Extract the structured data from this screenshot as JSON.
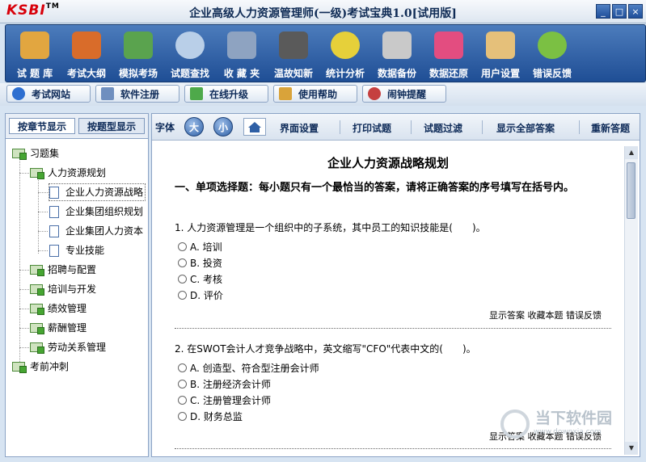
{
  "window": {
    "logo": "KSBI",
    "logo_tm": "TM",
    "title": "企业高级人力资源管理师(一级)考试宝典1.0[试用版]",
    "buttons": [
      "_",
      "□",
      "×"
    ]
  },
  "toolbar": [
    {
      "label": "试 题 库",
      "icon": "book-icon",
      "color": "#e2a640"
    },
    {
      "label": "考试大纲",
      "icon": "calendar-icon",
      "color": "#d96c2a"
    },
    {
      "label": "模拟考场",
      "icon": "clock-icon",
      "color": "#5aa34e"
    },
    {
      "label": "试题查找",
      "icon": "magnifier-icon",
      "color": "#b9cfe8"
    },
    {
      "label": "收 藏 夹",
      "icon": "folder-icon",
      "color": "#8ea3c1"
    },
    {
      "label": "温故知新",
      "icon": "board-icon",
      "color": "#5a5a5a"
    },
    {
      "label": "统计分析",
      "icon": "pie-chart-icon",
      "color": "#e6d03a"
    },
    {
      "label": "数据备份",
      "icon": "disk-icon",
      "color": "#c9c9c9"
    },
    {
      "label": "数据还原",
      "icon": "restore-icon",
      "color": "#e34d80"
    },
    {
      "label": "用户设置",
      "icon": "user-icon",
      "color": "#e5c07a"
    },
    {
      "label": "错误反馈",
      "icon": "refresh-icon",
      "color": "#7bc043"
    }
  ],
  "subbar": [
    {
      "label": "考试网站",
      "icon": "ie-icon",
      "color": "#2e6fd0"
    },
    {
      "label": "软件注册",
      "icon": "register-icon",
      "color": "#6f8fbf"
    },
    {
      "label": "在线升级",
      "icon": "download-icon",
      "color": "#4ea94a"
    },
    {
      "label": "使用帮助",
      "icon": "help-icon",
      "color": "#d9a33a"
    },
    {
      "label": "闹钟提醒",
      "icon": "alarm-icon",
      "color": "#c54040"
    }
  ],
  "left_tabs": [
    "按章节显示",
    "按题型显示"
  ],
  "tree": [
    {
      "label": "习题集",
      "type": "folder"
    },
    {
      "label": "人力资源规划",
      "type": "folder"
    },
    {
      "label": "企业人力资源战略",
      "type": "doc"
    },
    {
      "label": "企业集团组织规划",
      "type": "doc"
    },
    {
      "label": "企业集团人力资本",
      "type": "doc"
    },
    {
      "label": "专业技能",
      "type": "doc"
    },
    {
      "label": "招聘与配置",
      "type": "folder"
    },
    {
      "label": "培训与开发",
      "type": "folder"
    },
    {
      "label": "绩效管理",
      "type": "folder"
    },
    {
      "label": "薪酬管理",
      "type": "folder"
    },
    {
      "label": "劳动关系管理",
      "type": "folder"
    },
    {
      "label": "考前冲刺",
      "type": "folder"
    }
  ],
  "right_toolbar": {
    "font_label": "字体",
    "big": "大",
    "small": "小",
    "items": [
      "界面设置",
      "打印试题",
      "试题过滤",
      "显示全部答案",
      "重新答题"
    ]
  },
  "content": {
    "title": "企业人力资源战略规划",
    "section": "一、单项选择题：每小题只有一个最恰当的答案，请将正确答案的序号填写在括号内。",
    "questions": [
      {
        "text": "1. 人力资源管理是一个组织中的子系统，其中员工的知识技能是(　　)。",
        "options": [
          "A. 培训",
          "B. 投资",
          "C. 考核",
          "D. 评价"
        ]
      },
      {
        "text": "2. 在SWOT会计人才竞争战略中，英文缩写\"CFO\"代表中文的(　　)。",
        "options": [
          "A. 创造型、符合型注册会计师",
          "B. 注册经济会计师",
          "C. 注册管理会计师",
          "D. 财务总监"
        ]
      }
    ],
    "action_links": "显示答案 收藏本题 错误反馈"
  },
  "watermark": {
    "text": "当下软件园",
    "url": "www.downxia.com"
  }
}
